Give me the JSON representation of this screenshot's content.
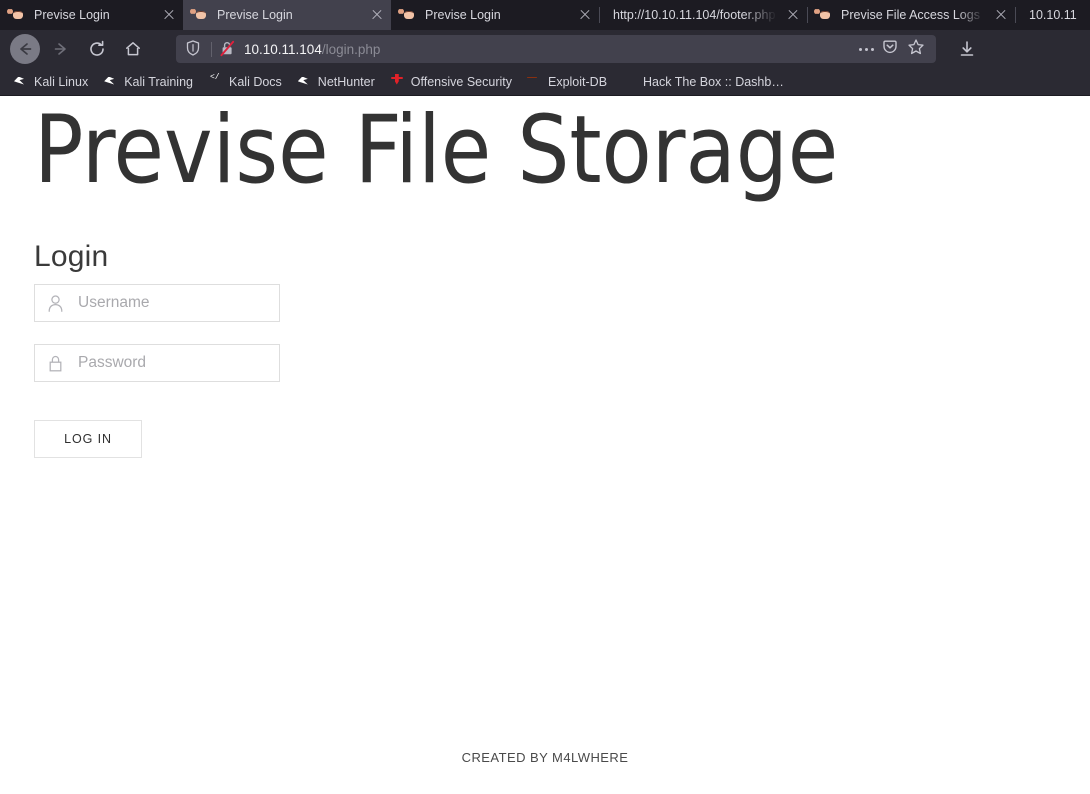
{
  "browser": {
    "tabs": [
      {
        "title": "Previse Login",
        "favicon": "ape-icon",
        "active": false,
        "closable": true
      },
      {
        "title": "Previse Login",
        "favicon": "ape-icon",
        "active": true,
        "closable": true
      },
      {
        "title": "Previse Login",
        "favicon": "ape-icon",
        "active": false,
        "closable": true
      },
      {
        "title": "http://10.10.11.104/footer.php",
        "favicon": "none",
        "active": false,
        "closable": true
      },
      {
        "title": "Previse File Access Logs",
        "favicon": "ape-icon",
        "active": false,
        "closable": true
      },
      {
        "title": "10.10.11",
        "favicon": "none",
        "active": false,
        "closable": false
      }
    ],
    "nav": {
      "back_label": "Back",
      "forward_label": "Forward",
      "reload_label": "Reload",
      "home_label": "Home",
      "download_label": "Downloads"
    },
    "urlbar": {
      "shield_icon": "shield-icon",
      "security_icon": "lock-crossed-out-icon",
      "url_host": "10.10.11.104",
      "url_path": "/login.php",
      "full_url": "10.10.11.104/login.php",
      "page_actions_icon": "ellipsis-icon",
      "pocket_icon": "pocket-icon",
      "bookmark_icon": "star-icon"
    },
    "bookmarks": [
      {
        "label": "Kali Linux",
        "icon": "kali-dragon-icon"
      },
      {
        "label": "Kali Training",
        "icon": "kali-training-icon"
      },
      {
        "label": "Kali Docs",
        "icon": "kali-docs-icon"
      },
      {
        "label": "NetHunter",
        "icon": "nethunter-icon"
      },
      {
        "label": "Offensive Security",
        "icon": "offensive-security-sword-icon"
      },
      {
        "label": "Exploit-DB",
        "icon": "exploit-db-bug-icon"
      },
      {
        "label": "Hack The Box :: Dashb…",
        "icon": "hack-the-box-cube-icon"
      }
    ]
  },
  "page": {
    "title": "Previse File Storage",
    "login_heading": "Login",
    "username": {
      "placeholder": "Username",
      "value": "",
      "icon": "user-icon"
    },
    "password": {
      "placeholder": "Password",
      "value": "",
      "icon": "lock-icon"
    },
    "submit_label": "LOG IN",
    "footer_text": "CREATED BY M4LWHERE"
  },
  "colors": {
    "chrome_dark": "#1c1b22",
    "chrome_bar": "#2b2a33",
    "tab_active": "#42414d",
    "page_bg": "#ffffff",
    "heading_text": "#333333",
    "placeholder": "#a9a9ad",
    "field_border": "#dedede"
  }
}
